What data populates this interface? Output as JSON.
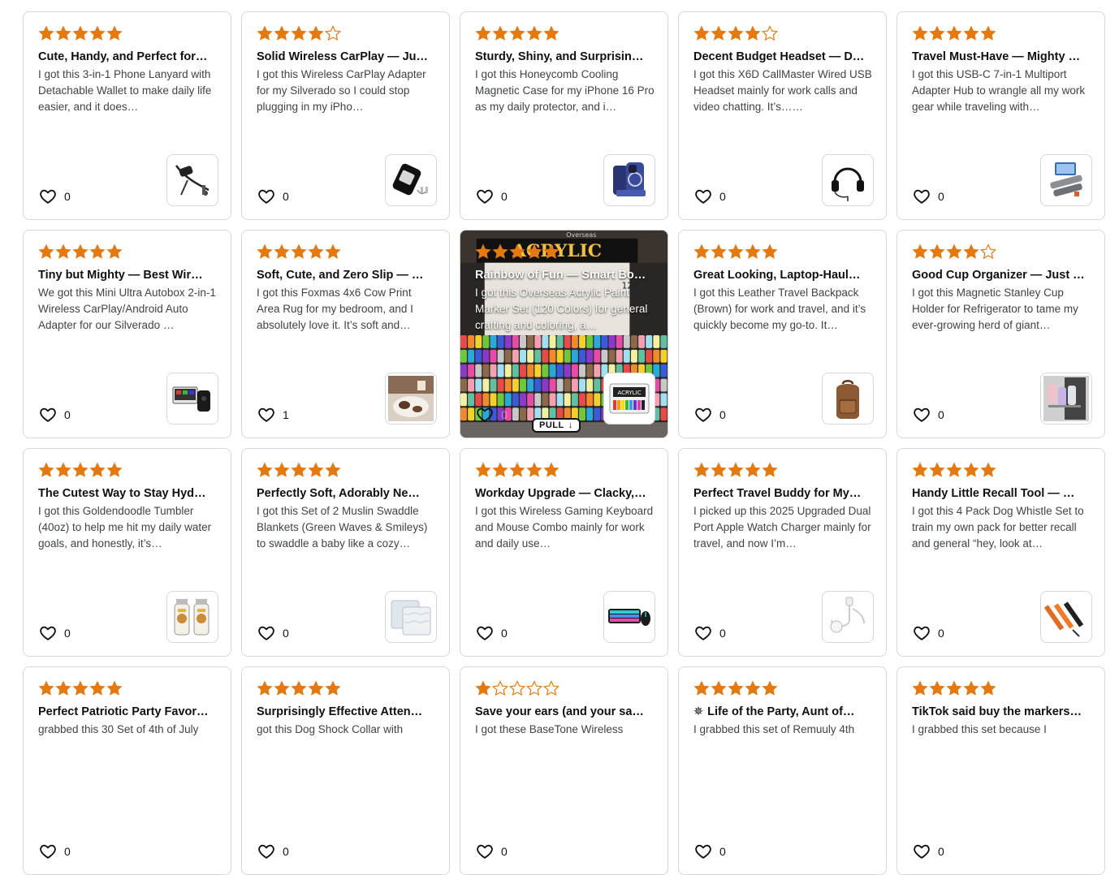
{
  "colors": {
    "star": "#e47911",
    "star_outline": "#e47911",
    "border": "#d5d9d9",
    "text": "#0f1111",
    "body_text": "#3e4444"
  },
  "cards": [
    {
      "rating": 5,
      "title": "Cute, Handy, and Perfect for…",
      "body": "I got this 3-in-1 Phone Lanyard with Detachable Wallet to make daily life easier, and it does…",
      "likes": "0",
      "thumb": "phone-lanyard"
    },
    {
      "rating": 4,
      "title": "Solid Wireless CarPlay — Ju…",
      "body": "I got this Wireless CarPlay Adapter for my Silverado so I could stop plugging in my iPho…",
      "likes": "0",
      "thumb": "carplay-adapter"
    },
    {
      "rating": 5,
      "title": "Sturdy, Shiny, and Surprisin…",
      "body": "I got this Honeycomb Cooling Magnetic Case for my iPhone 16 Pro as my daily protector, and i…",
      "likes": "0",
      "thumb": "phone-case"
    },
    {
      "rating": 4,
      "title": "Decent Budget Headset — D…",
      "body": "I got this X6D CallMaster Wired USB Headset mainly for work calls and video chatting. It’s……",
      "likes": "0",
      "thumb": "headset"
    },
    {
      "rating": 5,
      "title": "Travel Must-Have — Mighty …",
      "body": "I got this USB-C 7-in-1 Multiport Adapter Hub to wrangle all my work gear while traveling with…",
      "likes": "0",
      "thumb": "usb-hub"
    },
    {
      "rating": 5,
      "title": "Tiny but Mighty — Best Wir…",
      "body": "We got this Mini Ultra Autobox 2-in-1 Wireless CarPlay/Android Auto Adapter for our Silverado …",
      "likes": "0",
      "thumb": "autobox"
    },
    {
      "rating": 5,
      "title": "Soft, Cute, and Zero Slip — …",
      "body": "I got this Foxmas 4x6 Cow Print Area Rug for my bedroom, and I absolutely love it. It’s soft and…",
      "likes": "1",
      "thumb": "cow-rug"
    },
    {
      "rating": 5,
      "title": "Rainbow of Fun — Smart Bo…",
      "body": "I got this Overseas Acrylic Paint Marker Set (120 Colors) for general crafting and coloring, a…",
      "likes": "0",
      "thumb": "markers",
      "photo": true,
      "pull_label": "PULL",
      "photo_texts": {
        "brand": "Overseas",
        "word": "ACRYLIC",
        "count": "120"
      }
    },
    {
      "rating": 5,
      "title": "Great Looking, Laptop-Haul…",
      "body": "I got this Leather Travel Backpack (Brown) for work and travel, and it’s quickly become my go-to. It…",
      "likes": "0",
      "thumb": "backpack"
    },
    {
      "rating": 4,
      "title": "Good Cup Organizer — Just …",
      "body": "I got this Magnetic Stanley Cup Holder for Refrigerator to tame my ever-growing herd of giant…",
      "likes": "0",
      "thumb": "cup-holder"
    },
    {
      "rating": 5,
      "title": "The Cutest Way to Stay Hyd…",
      "body": "I got this Goldendoodle Tumbler (40oz) to help me hit my daily water goals, and honestly, it’s…",
      "likes": "0",
      "thumb": "tumbler"
    },
    {
      "rating": 5,
      "title": "Perfectly Soft, Adorably Ne…",
      "body": "I got this Set of 2 Muslin Swaddle Blankets (Green Waves & Smileys) to swaddle a baby like a cozy…",
      "likes": "0",
      "thumb": "swaddle"
    },
    {
      "rating": 5,
      "title": "Workday Upgrade — Clacky,…",
      "body": "I got this Wireless Gaming Keyboard and Mouse Combo mainly for work and daily use…",
      "likes": "0",
      "thumb": "keyboard"
    },
    {
      "rating": 5,
      "title": "Perfect Travel Buddy for My…",
      "body": "I picked up this 2025 Upgraded Dual Port Apple Watch Charger mainly for travel, and now I’m…",
      "likes": "0",
      "thumb": "watch-charger"
    },
    {
      "rating": 5,
      "title": "Handy Little Recall Tool — …",
      "body": "I got this 4 Pack Dog Whistle Set to train my own pack for better recall and general “hey, look at…",
      "likes": "0",
      "thumb": "dog-whistle"
    },
    {
      "rating": 5,
      "title": "Perfect Patriotic Party Favor…",
      "body": "grabbed this 30 Set of 4th of July",
      "likes": "0",
      "thumb": "none"
    },
    {
      "rating": 5,
      "title": "Surprisingly Effective Atten…",
      "body": "got this Dog Shock Collar with",
      "likes": "0",
      "thumb": "none"
    },
    {
      "rating": 1,
      "title": "Save your ears (and your sa…",
      "body": "I got these BaseTone Wireless",
      "likes": "0",
      "thumb": "none"
    },
    {
      "rating": 5,
      "title": "Life of the Party, Aunt of…",
      "title_symbol": "✵",
      "body": "I grabbed this set of Remuuly 4th",
      "likes": "0",
      "thumb": "none"
    },
    {
      "rating": 5,
      "title": "TikTok said buy the markers…",
      "body": "I grabbed this set because I",
      "likes": "0",
      "thumb": "none"
    }
  ]
}
